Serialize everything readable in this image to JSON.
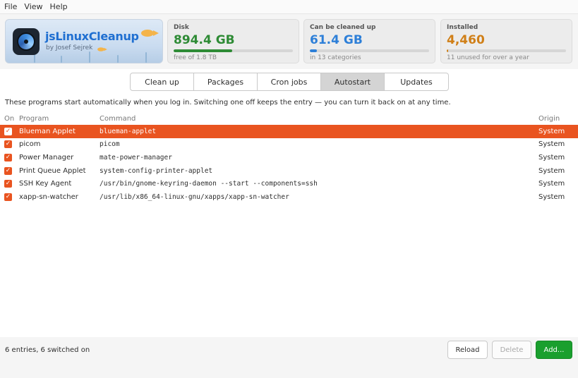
{
  "menu": [
    "File",
    "View",
    "Help"
  ],
  "banner": {
    "title": "jsLinuxCleanup",
    "byline": "by Josef Sejrek"
  },
  "cards": [
    {
      "label": "Disk",
      "value": "894.4 GB",
      "sub": "free of 1.8 TB",
      "fraction": 0.49,
      "color": "#2e8b35"
    },
    {
      "label": "Can be cleaned up",
      "value": "61.4 GB",
      "sub": "in 13 categories",
      "fraction": 0.06,
      "color": "#2d7fd8"
    },
    {
      "label": "Installed",
      "value": "4,460",
      "sub": "11 unused for over a year",
      "fraction": 0.01,
      "color": "#d07f17"
    }
  ],
  "tabs": [
    {
      "label": "Clean up",
      "active": false
    },
    {
      "label": "Packages",
      "active": false
    },
    {
      "label": "Cron jobs",
      "active": false
    },
    {
      "label": "Autostart",
      "active": true
    },
    {
      "label": "Updates",
      "active": false
    }
  ],
  "description": "These programs start automatically when you log in. Switching one off keeps the entry — you can turn it back on at any time.",
  "columns": {
    "on": "On",
    "program": "Program",
    "command": "Command",
    "origin": "Origin"
  },
  "entries": [
    {
      "program": "Blueman Applet",
      "command": "blueman-applet",
      "origin": "System",
      "enabled": true,
      "selected": true
    },
    {
      "program": "picom",
      "command": "picom",
      "origin": "System",
      "enabled": true,
      "selected": false
    },
    {
      "program": "Power Manager",
      "command": "mate-power-manager",
      "origin": "System",
      "enabled": true,
      "selected": false
    },
    {
      "program": "Print Queue Applet",
      "command": "system-config-printer-applet",
      "origin": "System",
      "enabled": true,
      "selected": false
    },
    {
      "program": "SSH Key Agent",
      "command": "/usr/bin/gnome-keyring-daemon --start --components=ssh",
      "origin": "System",
      "enabled": true,
      "selected": false
    },
    {
      "program": "xapp-sn-watcher",
      "command": "/usr/lib/x86_64-linux-gnu/xapps/xapp-sn-watcher",
      "origin": "System",
      "enabled": true,
      "selected": false
    }
  ],
  "footer": {
    "status": "6 entries, 6 switched on",
    "reload": "Reload",
    "delete": "Delete",
    "add": "Add..."
  },
  "icons": {
    "check": "checkmark-icon",
    "logo": "app-logo-icon"
  }
}
